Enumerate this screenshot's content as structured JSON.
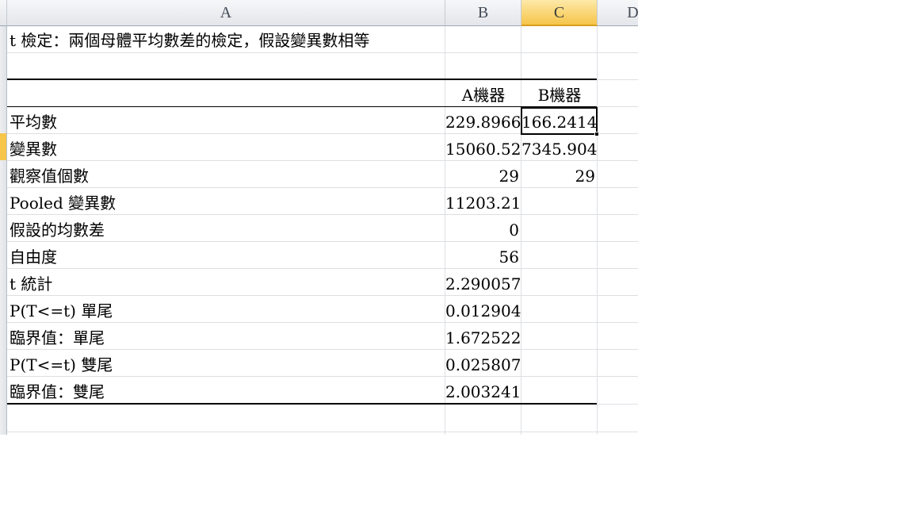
{
  "columns": [
    "A",
    "B",
    "C",
    "D"
  ],
  "selected_column": "C",
  "title": "t 檢定：兩個母體平均數差的檢定，假設變異數相等",
  "headers": {
    "b": "A機器",
    "c": "B機器"
  },
  "rows": [
    {
      "label": "平均數",
      "b": "229.8966",
      "c": "166.2414"
    },
    {
      "label": "變異數",
      "b": "15060.52",
      "c": "7345.904"
    },
    {
      "label": "觀察值個數",
      "b": "29",
      "c": "29"
    },
    {
      "label": "Pooled 變異數",
      "b": "11203.21",
      "c": ""
    },
    {
      "label": "假設的均數差",
      "b": "0",
      "c": ""
    },
    {
      "label": "自由度",
      "b": "56",
      "c": ""
    },
    {
      "label": "t 統計",
      "b": "2.290057",
      "c": ""
    },
    {
      "label": "P(T<=t) 單尾",
      "b": "0.012904",
      "c": ""
    },
    {
      "label": "臨界值：單尾",
      "b": "1.672522",
      "c": ""
    },
    {
      "label": "P(T<=t) 雙尾",
      "b": "0.025807",
      "c": ""
    },
    {
      "label": "臨界值：雙尾",
      "b": "2.003241",
      "c": ""
    }
  ],
  "active_cell": "C4",
  "colors": {
    "selected_header": "#f6c54a",
    "gridline": "#dcdfe3",
    "border": "#000000"
  }
}
